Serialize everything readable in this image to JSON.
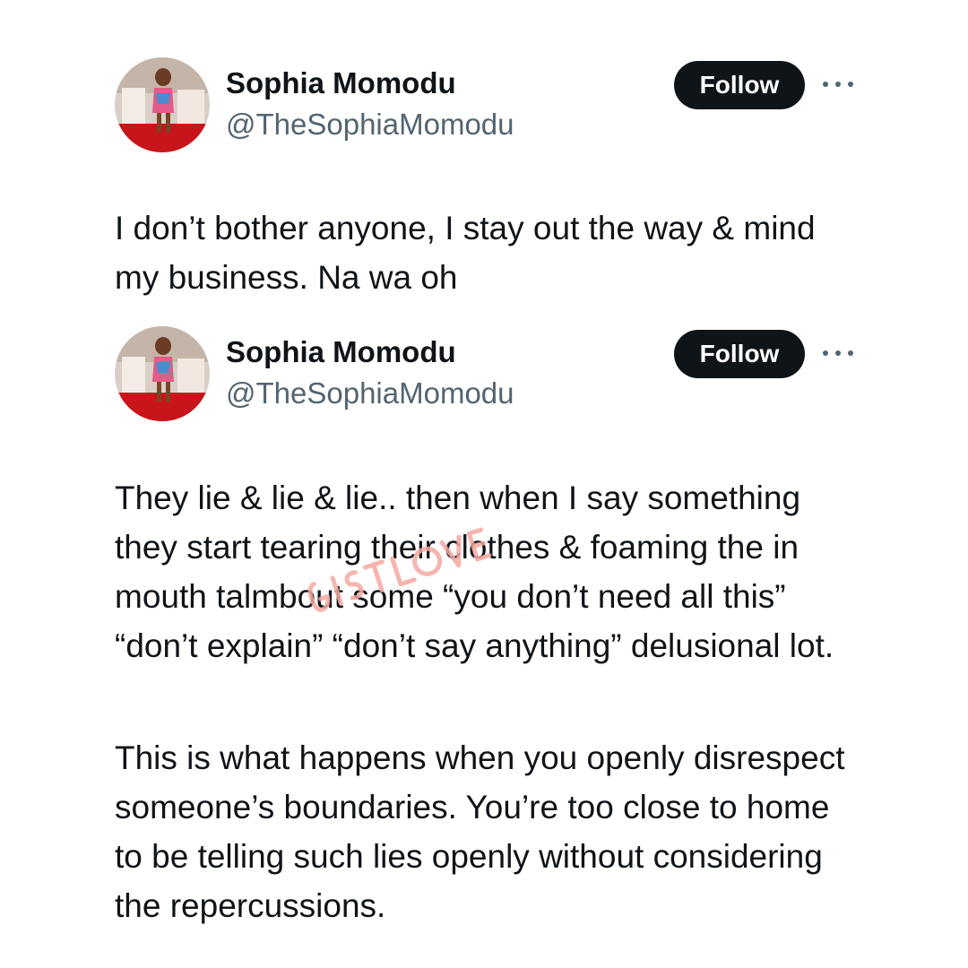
{
  "tweets": [
    {
      "author": {
        "display_name": "Sophia Momodu",
        "handle": "@TheSophiaMomodu"
      },
      "follow_label": "Follow",
      "more_icon": "more-horizontal-icon",
      "text": [
        "I don’t bother anyone, I stay out the way & mind my business. Na wa oh"
      ]
    },
    {
      "author": {
        "display_name": "Sophia Momodu",
        "handle": "@TheSophiaMomodu"
      },
      "follow_label": "Follow",
      "more_icon": "more-horizontal-icon",
      "text": [
        "They lie & lie & lie.. then when I say something they start tearing their clothes & foaming the in mouth talmbout some “you don’t need all this” “don’t explain” “don’t say anything” delusional lot.",
        "This is what happens when you openly disrespect someone’s boundaries. You’re too close to home to be telling such lies openly without considering the repercussions."
      ]
    }
  ],
  "watermark": {
    "text": "GISTLOVER",
    "color": "#f4a9a0"
  },
  "colors": {
    "text": "#0f1419",
    "secondary": "#536471",
    "button": "#0f1419",
    "button_text": "#ffffff"
  }
}
